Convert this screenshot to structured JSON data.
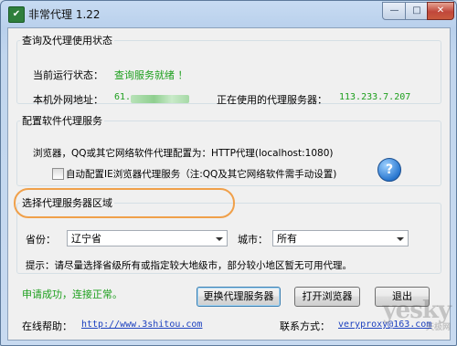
{
  "window": {
    "title": "非常代理 1.22",
    "controls": {
      "min": "—",
      "max": "□",
      "close": "✕"
    }
  },
  "status_group": {
    "legend": "查询及代理使用状态",
    "run_status_label": "当前运行状态：",
    "run_status_value": "查询服务就绪 ！",
    "local_ip_label": "本机外网地址：",
    "local_ip_value": "61.",
    "proxy_in_use_label": "正在使用的代理服务器：",
    "proxy_in_use_value": "113.233.7.207"
  },
  "config_group": {
    "legend": "配置软件代理服务",
    "browser_line": "浏览器，QQ或其它网络软件代理配置为：HTTP代理(localhost:1080)",
    "auto_config_checkbox_label": "自动配置IE浏览器代理服务（注:QQ及其它网络软件需手动设置)",
    "help_glyph": "?"
  },
  "region_group": {
    "legend": "选择代理服务器区域",
    "province_label": "省份：",
    "province_value": "辽宁省",
    "city_label": "城市：",
    "city_value": "所有",
    "tip": "提示：请尽量选择省级所有或指定较大地级市，部分较小地区暂无可用代理。"
  },
  "footer": {
    "status_message": "申请成功，连接正常。",
    "change_proxy_button": "更换代理服务器",
    "open_browser_button": "打开浏览器",
    "exit_button": "退出",
    "help_label": "在线帮助：",
    "help_url": "http://www.3shitou.com",
    "contact_label": "联系方式：",
    "contact_value": "veryproxy@163.com"
  },
  "watermark": {
    "brand": "yesky",
    "sub": "天极网"
  },
  "colors": {
    "status_green": "#1d9f1d",
    "link_blue": "#1a3fbf",
    "highlight_orange": "#f0a04a"
  }
}
